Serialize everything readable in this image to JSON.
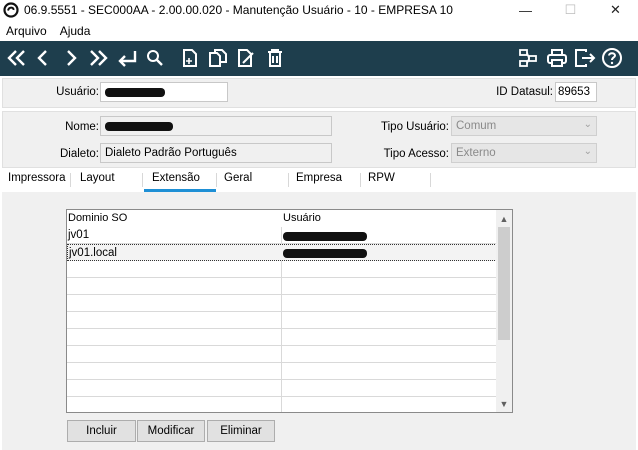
{
  "window": {
    "title": "06.9.5551 - SEC000AA - 2.00.00.020 - Manutenção Usuário - 10 - EMPRESA 10",
    "minimize_icon": "minimize-icon",
    "maximize_icon": "maximize-icon",
    "close_icon": "close-icon"
  },
  "menu": {
    "items": [
      "Arquivo",
      "Ajuda"
    ]
  },
  "toolbar": {
    "left_icons": [
      "first-icon",
      "previous-icon",
      "next-icon",
      "last-icon",
      "return-icon",
      "search-icon",
      "new-icon",
      "copy-icon",
      "edit-icon",
      "delete-icon"
    ],
    "right_icons": [
      "structure-icon",
      "print-icon",
      "exit-icon",
      "help-icon"
    ]
  },
  "header": {
    "usuario_label": "Usuário:",
    "id_datasul_label": "ID Datasul:",
    "id_datasul_value": "89653"
  },
  "details": {
    "nome_label": "Nome:",
    "dialeto_label": "Dialeto:",
    "dialeto_value": "Dialeto Padrão Português",
    "tipo_usuario_label": "Tipo Usuário:",
    "tipo_usuario_value": "Comum",
    "tipo_acesso_label": "Tipo Acesso:",
    "tipo_acesso_value": "Externo"
  },
  "tabs": [
    "Impressora",
    "Layout",
    "Extensão",
    "Geral",
    "Empresa",
    "RPW"
  ],
  "active_tab": "Extensão",
  "grid": {
    "columns": [
      "Dominio SO",
      "Usuário"
    ],
    "rows": [
      {
        "dominio": "jv01"
      },
      {
        "dominio": "jv01.local"
      }
    ]
  },
  "buttons": {
    "incluir": "Incluir",
    "modificar": "Modificar",
    "eliminar": "Eliminar"
  },
  "colors": {
    "toolbar_bg": "#1e3e4d",
    "tab_accent": "#1e8fd5",
    "panel_bg": "#f0f0f0"
  }
}
